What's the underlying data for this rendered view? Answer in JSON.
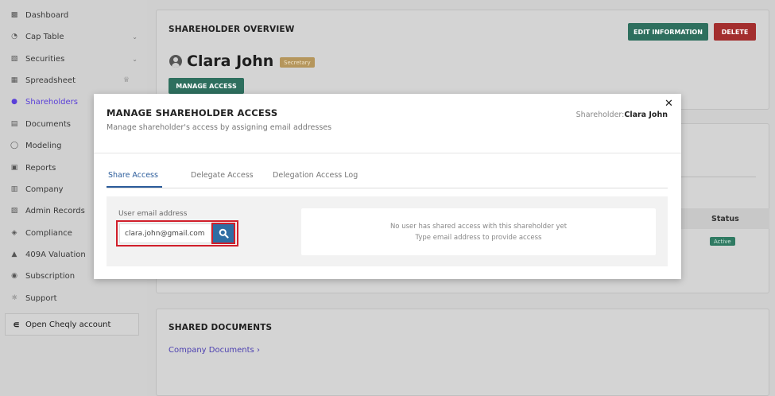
{
  "sidebar": {
    "items": [
      {
        "label": "Dashboard",
        "icon": "dashboard-icon"
      },
      {
        "label": "Cap Table",
        "icon": "pie-chart-icon",
        "has_chevron": true
      },
      {
        "label": "Securities",
        "icon": "clipboard-icon",
        "has_chevron": true
      },
      {
        "label": "Spreadsheet",
        "icon": "spreadsheet-icon",
        "has_crown": true
      },
      {
        "label": "Shareholders",
        "icon": "user-icon",
        "active": true
      },
      {
        "label": "Documents",
        "icon": "documents-icon"
      },
      {
        "label": "Modeling",
        "icon": "lightbulb-icon"
      },
      {
        "label": "Reports",
        "icon": "reports-icon"
      },
      {
        "label": "Company",
        "icon": "building-icon"
      },
      {
        "label": "Admin Records",
        "icon": "admin-records-icon"
      },
      {
        "label": "Compliance",
        "icon": "shield-icon"
      },
      {
        "label": "409A Valuation",
        "icon": "valuation-icon"
      },
      {
        "label": "Subscription",
        "icon": "dollar-icon"
      },
      {
        "label": "Support",
        "icon": "support-icon"
      }
    ],
    "open_account": {
      "label": "Open Cheqly account",
      "icon": "cheqly-logo-icon"
    }
  },
  "overview": {
    "title": "SHAREHOLDER OVERVIEW",
    "edit_label": "EDIT INFORMATION",
    "delete_label": "DELETE",
    "name": "Clara John",
    "role": "Secretary",
    "manage_label": "MANAGE ACCESS"
  },
  "table": {
    "status_header": "Status",
    "status_value": "Active"
  },
  "documents": {
    "title": "SHARED DOCUMENTS",
    "link": "Company Documents"
  },
  "modal": {
    "title": "MANAGE SHAREHOLDER ACCESS",
    "subtitle": "Manage shareholder's access by assigning email addresses",
    "shareholder_label": "Shareholder:",
    "shareholder_name": "Clara John",
    "tabs": [
      {
        "label": "Share Access",
        "active": true
      },
      {
        "label": "Delegate Access"
      },
      {
        "label": "Delegation Access Log"
      }
    ],
    "email_label": "User email address",
    "email_value": "clara.john@gmail.com",
    "empty_line1": "No user has shared access with this shareholder yet",
    "empty_line2": "Type email address to provide access"
  },
  "colors": {
    "primary_green": "#2e6f5e",
    "danger_red": "#a32e2e",
    "tab_blue": "#2b5c9b",
    "highlight_red": "#d11f2b",
    "active_nav": "#5a3fd8"
  }
}
